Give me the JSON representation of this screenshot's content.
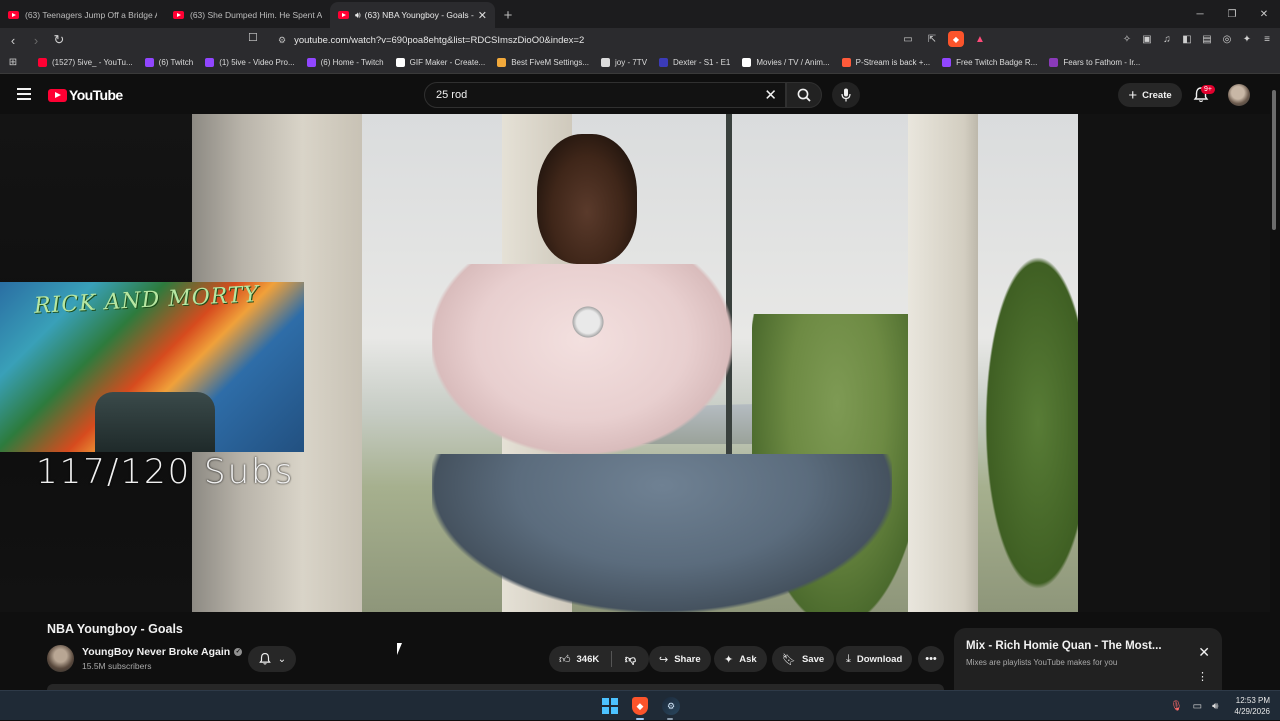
{
  "browser": {
    "tabs": [
      {
        "label": "(63) Teenagers Jump Off a Bridge Aft",
        "active": false
      },
      {
        "label": "(63) She Dumped Him. He Spent A Y",
        "active": false
      },
      {
        "label": "(63) NBA Youngboy - Goals -",
        "active": true
      }
    ],
    "new_tab": "+",
    "url": "youtube.com/watch?v=690poa8ehtg&list=RDCSImszDioO0&index=2",
    "bookmarks": [
      {
        "label": "(1527) 5ive_ - YouTu...",
        "color": "#ff0033"
      },
      {
        "label": "(6) Twitch",
        "color": "#9146ff"
      },
      {
        "label": "(1) 5ive - Video Pro...",
        "color": "#9146ff"
      },
      {
        "label": "(6) Home - Twitch",
        "color": "#9146ff"
      },
      {
        "label": "GIF Maker - Create...",
        "color": "#ffffff"
      },
      {
        "label": "Best FiveM Settings...",
        "color": "#f2a93b"
      },
      {
        "label": "joy - 7TV",
        "color": "#dcdcdc"
      },
      {
        "label": "Dexter - S1 - E1",
        "color": "#3b3bb8"
      },
      {
        "label": "Movies / TV / Anim...",
        "color": "#ffffff"
      },
      {
        "label": "P-Stream is back +...",
        "color": "#ff5a3a"
      },
      {
        "label": "Free Twitch Badge R...",
        "color": "#9146ff"
      },
      {
        "label": "Fears to Fathom - Ir...",
        "color": "#8a3ab9"
      }
    ]
  },
  "youtube": {
    "logo": "YouTube",
    "search_value": "25 rod",
    "create_label": "Create",
    "notif_badge": "9+"
  },
  "video": {
    "overlay_art_title": "RICK AND MORTY",
    "overlay_subs": "117/120 Subs",
    "title": "NBA Youngboy - Goals",
    "channel": "YoungBoy Never Broke Again",
    "subscribers": "15.5M subscribers",
    "likes": "346K",
    "actions": {
      "share": "Share",
      "ask": "Ask",
      "save": "Save",
      "download": "Download"
    }
  },
  "mix": {
    "title": "Mix - Rich Homie Quan - The Most...",
    "subtitle": "Mixes are playlists YouTube makes for you"
  },
  "taskbar": {
    "time": "12:53 PM",
    "date": "4/29/2026"
  },
  "colors": {
    "yt_red": "#ff0033",
    "bg": "#0f0f0f",
    "pill": "#272727"
  }
}
